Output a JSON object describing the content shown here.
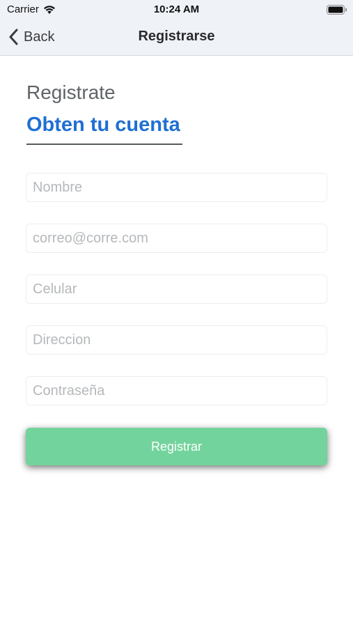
{
  "status_bar": {
    "carrier": "Carrier",
    "time": "10:24 AM",
    "wifi_icon": "wifi-icon",
    "battery_icon": "battery-icon"
  },
  "nav": {
    "back_label": "Back",
    "back_icon": "chevron-left-icon",
    "title": "Registrarse"
  },
  "form": {
    "subtitle": "Registrate",
    "title": "Obten tu cuenta",
    "fields": [
      {
        "placeholder": "Nombre",
        "value": ""
      },
      {
        "placeholder": "correo@corre.com",
        "value": ""
      },
      {
        "placeholder": "Celular",
        "value": ""
      },
      {
        "placeholder": "Direccion",
        "value": ""
      },
      {
        "placeholder": "Contraseña",
        "value": ""
      }
    ],
    "submit_label": "Registrar"
  },
  "colors": {
    "accent_title": "#1f6fd3",
    "button_bg": "#73d39c",
    "bar_bg": "#eff2f7"
  }
}
